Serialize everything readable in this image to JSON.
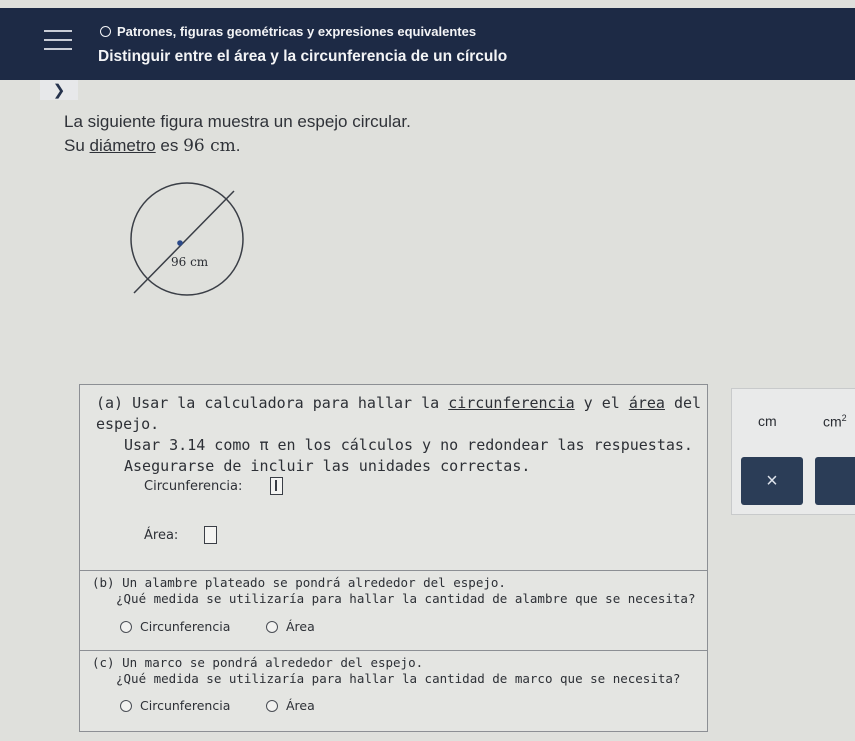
{
  "header": {
    "topic": "Patrones, figuras geométricas y expresiones equivalentes",
    "subtitle": "Distinguir entre el área y la circunferencia de un círculo"
  },
  "prompt": {
    "line1": "La siguiente figura muestra un espejo circular.",
    "line2_pre": "Su ",
    "line2_link": "diámetro",
    "line2_mid": " es ",
    "line2_value": "96 cm",
    "line2_end": "."
  },
  "figure": {
    "diameter_label": "96 cm"
  },
  "question": {
    "a": {
      "label": "(a)",
      "line1_pre": "Usar la calculadora para hallar la ",
      "line1_link1": "circunferencia",
      "line1_mid": " y el ",
      "line1_link2": "área",
      "line1_end": " del espejo.",
      "line2": "Usar 3.14 como π en los cálculos y no redondear las respuestas.",
      "line3": "Asegurarse de incluir las unidades correctas.",
      "circ_label": "Circunferencia:",
      "area_label": "Área:"
    },
    "b": {
      "label": "(b)",
      "line1": "Un alambre plateado se pondrá alrededor del espejo.",
      "line2": "¿Qué medida se utilizaría para hallar la cantidad de alambre que se necesita?",
      "opt1": "Circunferencia",
      "opt2": "Área"
    },
    "c": {
      "label": "(c)",
      "line1": "Un marco se pondrá alrededor del espejo.",
      "line2": "¿Qué medida se utilizaría para hallar la cantidad de marco que se necesita?",
      "opt1": "Circunferencia",
      "opt2": "Área"
    }
  },
  "toolbar": {
    "unit1": "cm",
    "unit2_base": "cm",
    "unit2_exp": "2",
    "clear": "×"
  }
}
